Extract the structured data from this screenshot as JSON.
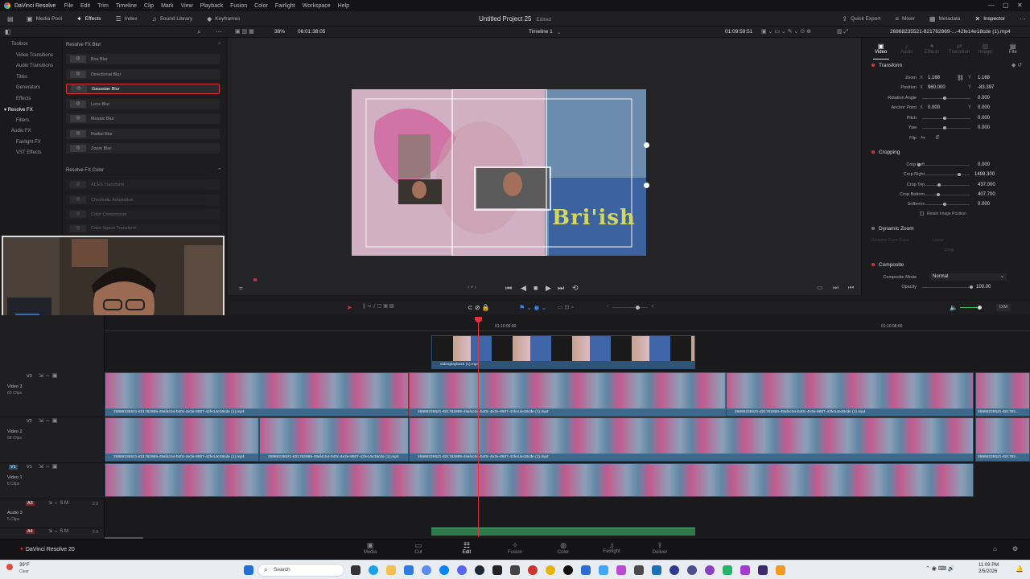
{
  "menubar": {
    "app": "DaVinci Resolve",
    "items": [
      "File",
      "Edit",
      "Trim",
      "Timeline",
      "Clip",
      "Mark",
      "View",
      "Playback",
      "Fusion",
      "Color",
      "Fairlight",
      "Workspace",
      "Help"
    ]
  },
  "toolbar": {
    "media_pool": "Media Pool",
    "effects": "Effects",
    "index": "Index",
    "sound_library": "Sound Library",
    "keyframes": "Keyframes",
    "project_title": "Untitled Project 25",
    "edited": "Edited",
    "quick_export": "Quick Export",
    "mixer": "Mixer",
    "metadata": "Metadata",
    "inspector": "Inspector"
  },
  "subbar": {
    "zoom": "38%",
    "timecode_left": "06:01:38:05",
    "timeline_name": "Timeline 1",
    "timecode_right": "01:09:59:51",
    "clip_name": "26868235521-821762869-...-42fe14e18cde (1).mp4"
  },
  "effects_panel": {
    "categories": [
      "Toolbox",
      "Video Transitions",
      "Audio Transitions",
      "Titles",
      "Generators",
      "Effects",
      "Resolve FX",
      "Filters",
      "Audio FX",
      "Fairlight FX",
      "VST Effects"
    ],
    "blur_header": "Resolve FX Blur",
    "blur_items": [
      "Box Blur",
      "Directional Blur",
      "Gaussian Blur",
      "Lens Blur",
      "Mosaic Blur",
      "Radial Blur",
      "Zoom Blur"
    ],
    "color_header": "Resolve FX Color",
    "color_items": [
      "ACES Transform",
      "Chromatic Adaptation",
      "Color Compressor",
      "Color Space Transform"
    ]
  },
  "viewer": {
    "overlay_text": "Bri'ish"
  },
  "inspector": {
    "tabs": [
      "Video",
      "Audio",
      "Effects",
      "Transition",
      "Image",
      "File"
    ],
    "transform_header": "Transform",
    "zoom_label": "Zoom",
    "zoom_x": "1.168",
    "zoom_y": "1.168",
    "position_label": "Position",
    "position_x": "960.000",
    "position_y": "-83.397",
    "rotation_label": "Rotation Angle",
    "rotation": "0.000",
    "anchor_label": "Anchor Point",
    "anchor_x": "0.000",
    "anchor_y": "0.000",
    "pitch_label": "Pitch",
    "pitch": "0.000",
    "yaw_label": "Yaw",
    "yaw": "0.000",
    "flip_label": "Flip",
    "cropping_header": "Cropping",
    "crop_left_label": "Crop Left",
    "crop_left": "0.000",
    "crop_right_label": "Crop Right",
    "crop_right": "1499.300",
    "crop_top_label": "Crop Top",
    "crop_top": "437.000",
    "crop_bottom_label": "Crop Bottom",
    "crop_bottom": "407.700",
    "softness_label": "Softness",
    "softness": "0.000",
    "retain_label": "Retain Image Position",
    "dynamic_zoom_header": "Dynamic Zoom",
    "dz_ease_label": "Dynamic Zoom Ease",
    "dz_ease": "Linear",
    "swap": "Swap",
    "composite_header": "Composite",
    "composite_mode_label": "Composite Mode",
    "composite_mode": "Normal",
    "opacity_label": "Opacity",
    "opacity": "100.00"
  },
  "timeline": {
    "ruler_1": "01:10:00:00",
    "ruler_2": "01:10:08:00",
    "dim": "DIM",
    "tracks": [
      {
        "id": "V3",
        "name": "Video 3",
        "sub": "60 Clips"
      },
      {
        "id": "V2",
        "name": "Video 2",
        "sub": "58 Clips"
      },
      {
        "id": "V1",
        "name": "Video 1",
        "sub": "6 Clips"
      },
      {
        "id": "A3",
        "name": "Audio 3",
        "sub": "5 Clips",
        "level": "2.0"
      },
      {
        "id": "A4",
        "name": "",
        "sub": "",
        "level": "2.0"
      }
    ],
    "floating_clip": "videoplayback (1).mp4",
    "clip_caption": "26868235521-821762869-49af4c54-b40c-4e2e-8607-42fe14e18cde (1).mp4",
    "clip_caption_short": "26868235521-821762...",
    "clip_caption_edge": "26868235521-821762..."
  },
  "pages": [
    "Media",
    "Cut",
    "Edit",
    "Fusion",
    "Color",
    "Fairlight",
    "Deliver"
  ],
  "bottom_app": "DaVinci Resolve 20",
  "taskbar": {
    "weather": "39°F",
    "weather_sub": "Clear",
    "search": "Search",
    "time": "11:09 PM",
    "date": "2/5/2026"
  },
  "colors": {
    "accent": "#e0323c",
    "clip": "#3d6a8c",
    "bg": "#1b1b1d"
  }
}
